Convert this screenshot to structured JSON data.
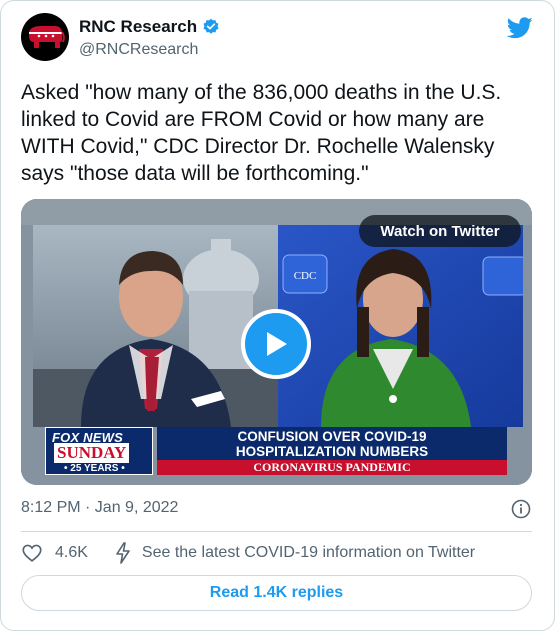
{
  "author": {
    "display_name": "RNC Research",
    "handle": "@RNCResearch",
    "verified": true,
    "avatar_icon": "gop-elephant-icon",
    "avatar_bg": "#000000",
    "avatar_accent": "#c8102e"
  },
  "brand_icon": "twitter-bird-icon",
  "tweet": {
    "text": "Asked \"how many of the 836,000 deaths in the U.S. linked to Covid are FROM Covid or how many are WITH Covid,\" CDC Director Dr. Rochelle Walensky says \"those data will be forthcoming.\""
  },
  "media": {
    "watch_label": "Watch on Twitter",
    "play_icon": "play-icon",
    "overlay": {
      "network": "FOX NEWS",
      "show": "SUNDAY",
      "anniversary": "• 25 YEARS •",
      "headline_line1": "CONFUSION OVER COVID-19",
      "headline_line2": "HOSPITALIZATION NUMBERS",
      "banner": "CORONAVIRUS PANDEMIC",
      "cdc_label": "CDC"
    }
  },
  "meta": {
    "timestamp": "8:12 PM · Jan 9, 2022",
    "info_icon": "info-icon"
  },
  "actions": {
    "like_count": "4.6K",
    "covid_info": "See the latest COVID-19 information on Twitter"
  },
  "replies_label": "Read 1.4K replies",
  "colors": {
    "accent": "#1d9bf0",
    "text": "#0f1419",
    "secondary": "#536471",
    "border": "#cfd9de"
  }
}
